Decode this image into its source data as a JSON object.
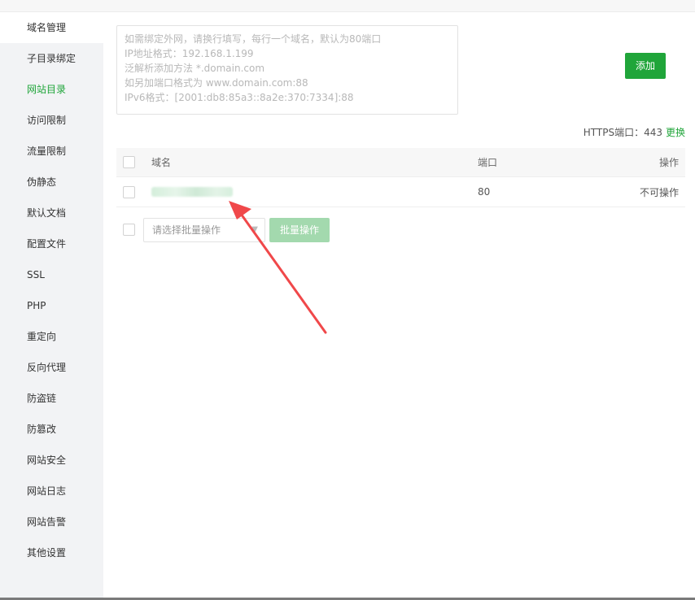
{
  "sidebar": {
    "items": [
      {
        "label": "域名管理"
      },
      {
        "label": "子目录绑定"
      },
      {
        "label": "网站目录"
      },
      {
        "label": "访问限制"
      },
      {
        "label": "流量限制"
      },
      {
        "label": "伪静态"
      },
      {
        "label": "默认文档"
      },
      {
        "label": "配置文件"
      },
      {
        "label": "SSL"
      },
      {
        "label": "PHP"
      },
      {
        "label": "重定向"
      },
      {
        "label": "反向代理"
      },
      {
        "label": "防盗链"
      },
      {
        "label": "防篡改"
      },
      {
        "label": "网站安全"
      },
      {
        "label": "网站日志"
      },
      {
        "label": "网站告警"
      },
      {
        "label": "其他设置"
      }
    ]
  },
  "domain_input": {
    "placeholder_lines": [
      "如需绑定外网，请换行填写，每行一个域名，默认为80端口",
      "IP地址格式：192.168.1.199",
      "泛解析添加方法 *.domain.com",
      "如另加端口格式为 www.domain.com:88",
      "IPv6格式：[2001:db8:85a3::8a2e:370:7334]:88"
    ]
  },
  "add_button": {
    "label": "添加"
  },
  "https": {
    "label": "HTTPS端口：443",
    "change_label": "更换"
  },
  "table": {
    "headers": {
      "domain": "域名",
      "port": "端口",
      "action": "操作"
    },
    "rows": [
      {
        "port": "80",
        "action": "不可操作"
      }
    ]
  },
  "batch": {
    "select_placeholder": "请选择批量操作",
    "button_label": "批量操作"
  },
  "colors": {
    "accent": "#20a53a",
    "annotation_arrow": "#f0484a"
  }
}
